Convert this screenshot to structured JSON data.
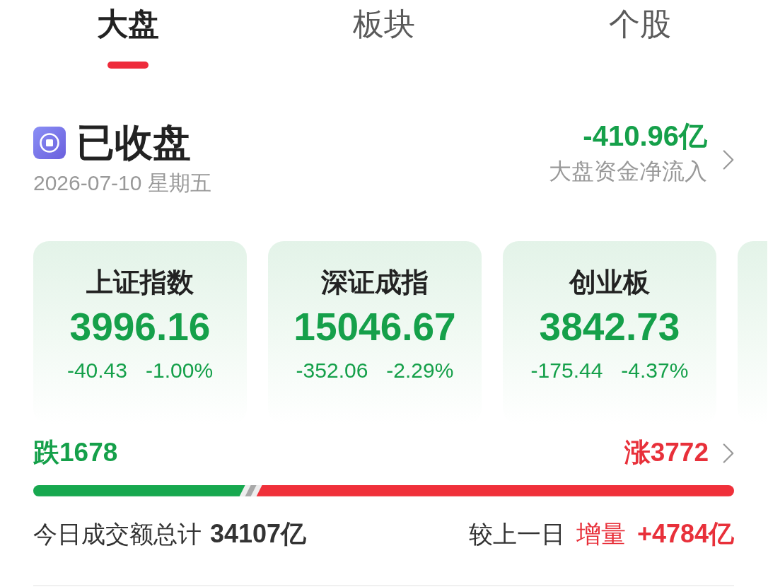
{
  "tabs": [
    {
      "label": "大盘",
      "selected": true
    },
    {
      "label": "板块",
      "selected": false
    },
    {
      "label": "个股",
      "selected": false
    }
  ],
  "market_status": {
    "title": "已收盘",
    "date": "2026-07-10 星期五",
    "net_inflow": {
      "value": "-410.96亿",
      "label": "大盘资金净流入",
      "kind": "down"
    }
  },
  "indices": [
    {
      "name": "上证指数",
      "value": "3996.16",
      "change": "-40.43",
      "change_pct": "-1.00%",
      "kind": "down"
    },
    {
      "name": "深证成指",
      "value": "15046.67",
      "change": "-352.06",
      "change_pct": "-2.29%",
      "kind": "down"
    },
    {
      "name": "创业板",
      "value": "3842.73",
      "change": "-175.44",
      "change_pct": "-4.37%",
      "kind": "down"
    }
  ],
  "breadth": {
    "counts": [
      {
        "kind": "down",
        "text": "跌1678"
      },
      {
        "kind": "up",
        "text": "涨3772"
      }
    ],
    "segments": [
      {
        "kind": "down",
        "level": 0.3
      },
      {
        "kind": "flat",
        "level": 0.02
      },
      {
        "kind": "up",
        "level": 0.68
      }
    ]
  },
  "turnover": {
    "label": "今日成交额总计",
    "value": "34107亿",
    "compare_label": "较上一日",
    "change_label": "增量",
    "change_value": "+4784亿",
    "kind": "up"
  }
}
